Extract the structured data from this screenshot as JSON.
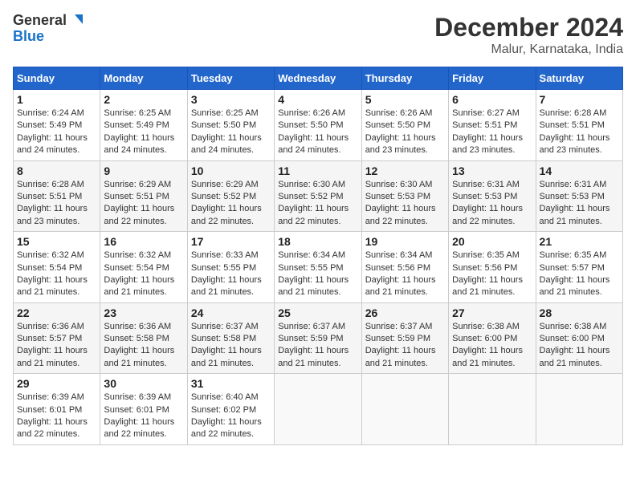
{
  "logo": {
    "line1": "General",
    "line2": "Blue"
  },
  "title": "December 2024",
  "location": "Malur, Karnataka, India",
  "headers": [
    "Sunday",
    "Monday",
    "Tuesday",
    "Wednesday",
    "Thursday",
    "Friday",
    "Saturday"
  ],
  "weeks": [
    [
      {
        "day": "1",
        "info": "Sunrise: 6:24 AM\nSunset: 5:49 PM\nDaylight: 11 hours\nand 24 minutes."
      },
      {
        "day": "2",
        "info": "Sunrise: 6:25 AM\nSunset: 5:49 PM\nDaylight: 11 hours\nand 24 minutes."
      },
      {
        "day": "3",
        "info": "Sunrise: 6:25 AM\nSunset: 5:50 PM\nDaylight: 11 hours\nand 24 minutes."
      },
      {
        "day": "4",
        "info": "Sunrise: 6:26 AM\nSunset: 5:50 PM\nDaylight: 11 hours\nand 24 minutes."
      },
      {
        "day": "5",
        "info": "Sunrise: 6:26 AM\nSunset: 5:50 PM\nDaylight: 11 hours\nand 23 minutes."
      },
      {
        "day": "6",
        "info": "Sunrise: 6:27 AM\nSunset: 5:51 PM\nDaylight: 11 hours\nand 23 minutes."
      },
      {
        "day": "7",
        "info": "Sunrise: 6:28 AM\nSunset: 5:51 PM\nDaylight: 11 hours\nand 23 minutes."
      }
    ],
    [
      {
        "day": "8",
        "info": "Sunrise: 6:28 AM\nSunset: 5:51 PM\nDaylight: 11 hours\nand 23 minutes."
      },
      {
        "day": "9",
        "info": "Sunrise: 6:29 AM\nSunset: 5:51 PM\nDaylight: 11 hours\nand 22 minutes."
      },
      {
        "day": "10",
        "info": "Sunrise: 6:29 AM\nSunset: 5:52 PM\nDaylight: 11 hours\nand 22 minutes."
      },
      {
        "day": "11",
        "info": "Sunrise: 6:30 AM\nSunset: 5:52 PM\nDaylight: 11 hours\nand 22 minutes."
      },
      {
        "day": "12",
        "info": "Sunrise: 6:30 AM\nSunset: 5:53 PM\nDaylight: 11 hours\nand 22 minutes."
      },
      {
        "day": "13",
        "info": "Sunrise: 6:31 AM\nSunset: 5:53 PM\nDaylight: 11 hours\nand 22 minutes."
      },
      {
        "day": "14",
        "info": "Sunrise: 6:31 AM\nSunset: 5:53 PM\nDaylight: 11 hours\nand 21 minutes."
      }
    ],
    [
      {
        "day": "15",
        "info": "Sunrise: 6:32 AM\nSunset: 5:54 PM\nDaylight: 11 hours\nand 21 minutes."
      },
      {
        "day": "16",
        "info": "Sunrise: 6:32 AM\nSunset: 5:54 PM\nDaylight: 11 hours\nand 21 minutes."
      },
      {
        "day": "17",
        "info": "Sunrise: 6:33 AM\nSunset: 5:55 PM\nDaylight: 11 hours\nand 21 minutes."
      },
      {
        "day": "18",
        "info": "Sunrise: 6:34 AM\nSunset: 5:55 PM\nDaylight: 11 hours\nand 21 minutes."
      },
      {
        "day": "19",
        "info": "Sunrise: 6:34 AM\nSunset: 5:56 PM\nDaylight: 11 hours\nand 21 minutes."
      },
      {
        "day": "20",
        "info": "Sunrise: 6:35 AM\nSunset: 5:56 PM\nDaylight: 11 hours\nand 21 minutes."
      },
      {
        "day": "21",
        "info": "Sunrise: 6:35 AM\nSunset: 5:57 PM\nDaylight: 11 hours\nand 21 minutes."
      }
    ],
    [
      {
        "day": "22",
        "info": "Sunrise: 6:36 AM\nSunset: 5:57 PM\nDaylight: 11 hours\nand 21 minutes."
      },
      {
        "day": "23",
        "info": "Sunrise: 6:36 AM\nSunset: 5:58 PM\nDaylight: 11 hours\nand 21 minutes."
      },
      {
        "day": "24",
        "info": "Sunrise: 6:37 AM\nSunset: 5:58 PM\nDaylight: 11 hours\nand 21 minutes."
      },
      {
        "day": "25",
        "info": "Sunrise: 6:37 AM\nSunset: 5:59 PM\nDaylight: 11 hours\nand 21 minutes."
      },
      {
        "day": "26",
        "info": "Sunrise: 6:37 AM\nSunset: 5:59 PM\nDaylight: 11 hours\nand 21 minutes."
      },
      {
        "day": "27",
        "info": "Sunrise: 6:38 AM\nSunset: 6:00 PM\nDaylight: 11 hours\nand 21 minutes."
      },
      {
        "day": "28",
        "info": "Sunrise: 6:38 AM\nSunset: 6:00 PM\nDaylight: 11 hours\nand 21 minutes."
      }
    ],
    [
      {
        "day": "29",
        "info": "Sunrise: 6:39 AM\nSunset: 6:01 PM\nDaylight: 11 hours\nand 22 minutes."
      },
      {
        "day": "30",
        "info": "Sunrise: 6:39 AM\nSunset: 6:01 PM\nDaylight: 11 hours\nand 22 minutes."
      },
      {
        "day": "31",
        "info": "Sunrise: 6:40 AM\nSunset: 6:02 PM\nDaylight: 11 hours\nand 22 minutes."
      },
      {
        "day": "",
        "info": ""
      },
      {
        "day": "",
        "info": ""
      },
      {
        "day": "",
        "info": ""
      },
      {
        "day": "",
        "info": ""
      }
    ]
  ]
}
